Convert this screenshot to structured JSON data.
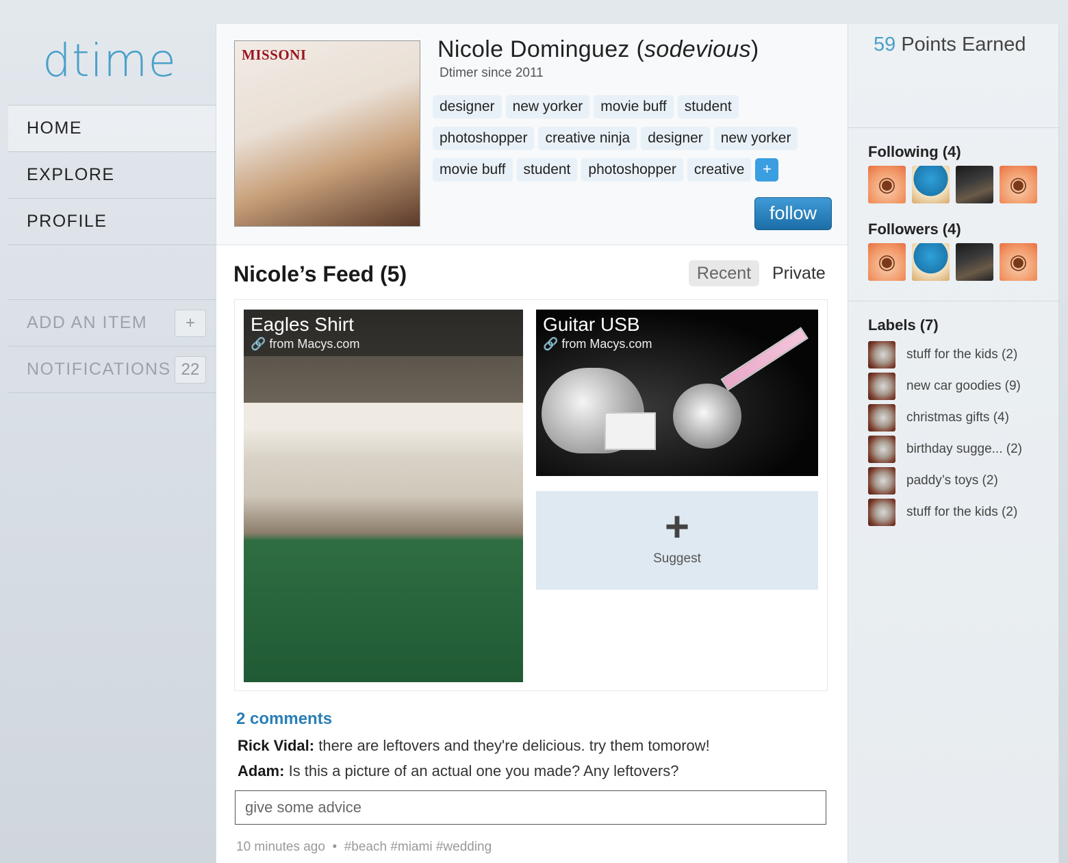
{
  "app": {
    "logo": "dtime"
  },
  "nav": {
    "items": [
      {
        "label": "HOME"
      },
      {
        "label": "EXPLORE"
      },
      {
        "label": "PROFILE"
      }
    ],
    "add_item": {
      "label": "ADD AN ITEM",
      "badge": "+"
    },
    "notifications": {
      "label": "NOTIFICATIONS",
      "count": "22"
    }
  },
  "profile": {
    "avatar_brand": "MISSONI",
    "name": "Nicole Dominguez",
    "username": "sodevious",
    "since": "Dtimer since 2011",
    "tags": [
      "designer",
      "new yorker",
      "movie buff",
      "student",
      "photoshopper",
      "creative ninja",
      "designer",
      "new yorker",
      "movie buff",
      "student",
      "photoshopper",
      "creative"
    ],
    "add_tag": "+",
    "follow_label": "follow"
  },
  "feed": {
    "title": "Nicole’s Feed (5)",
    "tabs": {
      "recent": "Recent",
      "private": "Private"
    },
    "cards": [
      {
        "title": "Eagles Shirt",
        "source": "from Macys.com"
      },
      {
        "title": "Guitar USB",
        "source": "from Macys.com"
      }
    ],
    "suggest": {
      "icon": "+",
      "label": "Suggest"
    },
    "comments_link": "2 comments",
    "comments": [
      {
        "author": "Rick Vidal:",
        "text": "there are leftovers and they're delicious. try them tomorow!"
      },
      {
        "author": "Adam:",
        "text": "Is this a picture of an actual one you made? Any leftovers?"
      }
    ],
    "comment_placeholder": "give some advice",
    "time": "10 minutes ago",
    "separator": "•",
    "hashtags": [
      "#beach",
      "#miami",
      "#wedding"
    ]
  },
  "right": {
    "points_num": "59",
    "points_label": "Points Earned",
    "following_title": "Following (4)",
    "followers_title": "Followers (4)",
    "following": [
      "peter-avatar",
      "cookie-avatar",
      "photo-avatar",
      "peter-avatar"
    ],
    "followers": [
      "peter-avatar",
      "cookie-avatar",
      "photo-avatar",
      "peter-avatar"
    ],
    "labels_title": "Labels (7)",
    "labels": [
      "stuff for the kids (2)",
      "new car goodies (9)",
      "christmas gifts (4)",
      "birthday sugge... (2)",
      "paddy’s toys (2)",
      "stuff for the kids (2)"
    ]
  },
  "colors": {
    "accent": "#4aa0c9",
    "follow_button": "#1c6ea8",
    "link": "#2a7fb5",
    "suggest_bg": "#dfe9f1"
  }
}
